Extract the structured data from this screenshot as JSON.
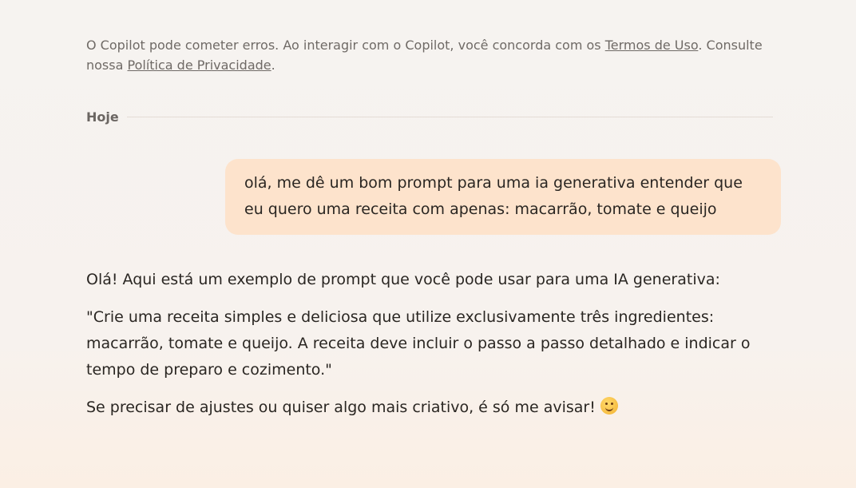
{
  "disclaimer": {
    "text_before": "O Copilot pode cometer erros. Ao interagir com o Copilot, você concorda com os ",
    "terms_link": "Termos de Uso",
    "text_middle": ". Consulte nossa ",
    "privacy_link": "Política de Privacidade",
    "text_after": "."
  },
  "divider": {
    "label": "Hoje"
  },
  "conversation": {
    "user_message": "olá, me dê um bom prompt para uma ia generativa entender que eu quero uma receita com apenas: macarrão, tomate e queijo",
    "assistant_paragraphs": [
      "Olá! Aqui está um exemplo de prompt que você pode usar para uma IA generativa:",
      "\"Crie uma receita simples e deliciosa que utilize exclusivamente três ingredientes: macarrão, tomate e queijo. A receita deve incluir o passo a passo detalhado e indicar o tempo de preparo e cozimento.\"",
      "Se precisar de ajustes ou quiser algo mais criativo, é só me avisar!"
    ],
    "emoji_icon": "smiling-face-emoji"
  },
  "colors": {
    "user_bubble": "#fde3cc",
    "background": "#f6f3f0",
    "text": "#2a2622",
    "muted_text": "#6f6a66"
  }
}
